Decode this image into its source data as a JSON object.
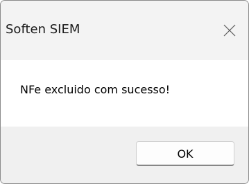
{
  "window": {
    "title": "Soften SIEM",
    "close_icon": "close-icon"
  },
  "message": {
    "text": "NFe excluido com sucesso!"
  },
  "buttons": {
    "ok_label": "OK"
  }
}
